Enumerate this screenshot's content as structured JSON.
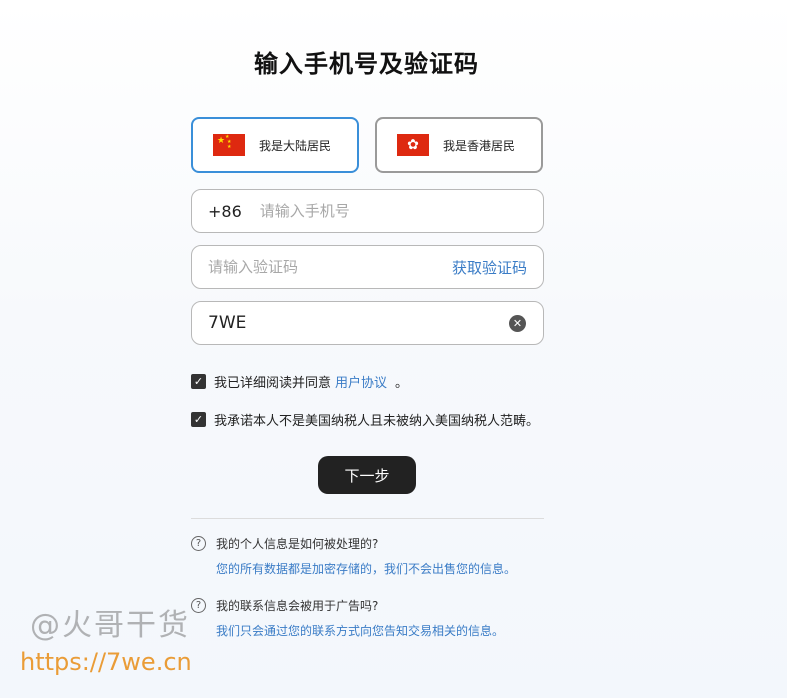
{
  "title": "输入手机号及验证码",
  "residents": {
    "mainland_label": "我是大陆居民",
    "hk_label": "我是香港居民"
  },
  "phone": {
    "prefix": "+86",
    "placeholder": "请输入手机号",
    "value": ""
  },
  "code": {
    "placeholder": "请输入验证码",
    "value": "",
    "get_code_label": "获取验证码"
  },
  "captcha": {
    "value": "7WE"
  },
  "agreements": {
    "row1_text": "我已详细阅读并同意",
    "row1_link": "用户协议",
    "row1_suffix": "。",
    "row2_text": "我承诺本人不是美国纳税人且未被纳入美国纳税人范畴。"
  },
  "next_label": "下一步",
  "faq": [
    {
      "question": "我的个人信息是如何被处理的?",
      "answer": "您的所有数据都是加密存储的，我们不会出售您的信息。"
    },
    {
      "question": "我的联系信息会被用于广告吗?",
      "answer": "我们只会通过您的联系方式向您告知交易相关的信息。"
    }
  ],
  "watermark": {
    "line1": "@火哥干货",
    "line2": "https://7we.cn"
  },
  "colors": {
    "accent": "#3a8fd9",
    "link": "#3a7cc6",
    "button": "#222222"
  },
  "icons": {
    "checkbox": "checkmark-icon",
    "clear": "clear-icon",
    "question": "question-circle-icon"
  }
}
